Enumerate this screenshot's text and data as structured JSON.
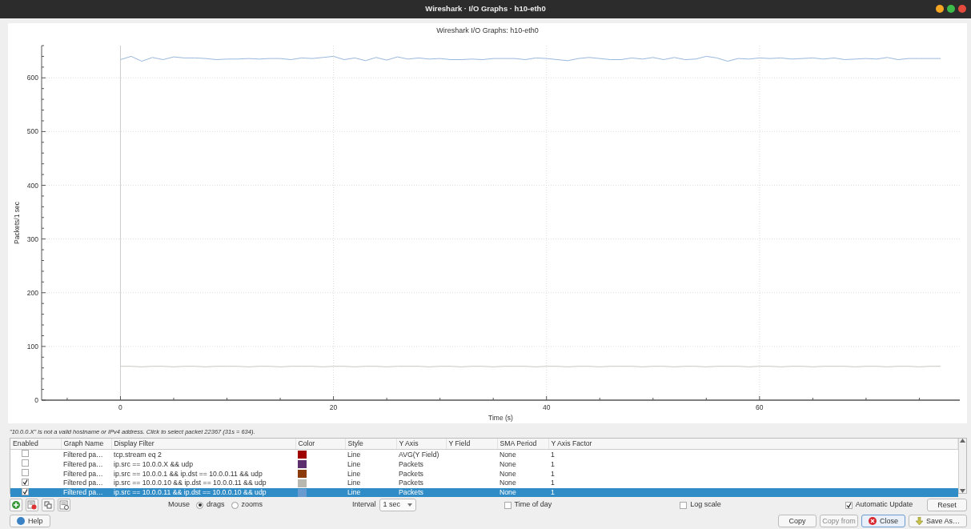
{
  "window": {
    "title": "Wireshark · I/O Graphs · h10-eth0"
  },
  "graph": {
    "chart_data": {
      "type": "line",
      "title": "Wireshark I/O Graphs: h10-eth0",
      "xlabel": "Time (s)",
      "ylabel": "Packets/1 sec",
      "x": [
        0,
        1,
        2,
        3,
        4,
        5,
        6,
        7,
        8,
        9,
        10,
        11,
        12,
        13,
        14,
        15,
        16,
        17,
        18,
        19,
        20,
        21,
        22,
        23,
        24,
        25,
        26,
        27,
        28,
        29,
        30,
        31,
        32,
        33,
        34,
        35,
        36,
        37,
        38,
        39,
        40,
        41,
        42,
        43,
        44,
        45,
        46,
        47,
        48,
        49,
        50,
        51,
        52,
        53,
        54,
        55,
        56,
        57,
        58,
        59,
        60,
        61,
        62,
        63,
        64,
        65,
        66,
        67,
        68,
        69,
        70,
        71,
        72,
        73,
        74,
        75,
        76,
        77
      ],
      "series": [
        {
          "color": "#9ab8dc",
          "values": [
            634,
            640,
            631,
            638,
            634,
            639,
            637,
            637,
            636,
            634,
            635,
            635,
            636,
            635,
            636,
            636,
            634,
            637,
            636,
            638,
            640,
            634,
            637,
            632,
            638,
            633,
            639,
            635,
            637,
            635,
            636,
            634,
            634,
            635,
            634,
            636,
            636,
            636,
            634,
            637,
            636,
            634,
            632,
            636,
            638,
            636,
            634,
            634,
            637,
            635,
            638,
            634,
            638,
            634,
            635,
            640,
            637,
            631,
            636,
            635,
            637,
            636,
            637,
            635,
            636,
            637,
            635,
            637,
            634,
            635,
            636,
            635,
            638,
            634,
            636,
            636,
            636,
            636
          ]
        },
        {
          "color": "#c8c8c2",
          "values": [
            63,
            63,
            62,
            63,
            63,
            62,
            63,
            63,
            62,
            63,
            63,
            63,
            62,
            63,
            63,
            62,
            63,
            63,
            63,
            62,
            63,
            63,
            62,
            63,
            63,
            62,
            63,
            63,
            63,
            62,
            63,
            63,
            62,
            63,
            63,
            62,
            63,
            63,
            63,
            62,
            63,
            63,
            62,
            63,
            63,
            62,
            63,
            63,
            63,
            62,
            63,
            63,
            62,
            63,
            63,
            62,
            63,
            63,
            63,
            62,
            63,
            63,
            62,
            63,
            63,
            62,
            63,
            63,
            63,
            62,
            63,
            63,
            62,
            63,
            63,
            62,
            63,
            63
          ]
        }
      ],
      "xlim": [
        -7.4,
        78.8
      ],
      "ylim": [
        0,
        660
      ],
      "xticks": [
        0,
        20,
        40,
        60
      ],
      "yticks": [
        0,
        100,
        200,
        300,
        400,
        500,
        600
      ],
      "grid": true
    }
  },
  "hint": "\"10.0.0.X\" is not a valid hostname or IPv4 address. Click to select packet 22367 (31s = 634).",
  "table": {
    "columns": [
      "Enabled",
      "Graph Name",
      "Display Filter",
      "Color",
      "Style",
      "Y Axis",
      "Y Field",
      "SMA Period",
      "Y Axis Factor"
    ],
    "rows": [
      {
        "enabled": false,
        "selected": false,
        "graph_name": "Filtered pa…",
        "display_filter": "tcp.stream eq 2",
        "color": "#a00000",
        "style": "Line",
        "y_axis": "AVG(Y Field)",
        "sma_period": "None",
        "y_axis_factor": "1"
      },
      {
        "enabled": false,
        "selected": false,
        "graph_name": "Filtered pa…",
        "display_filter": "ip.src == 10.0.0.X && udp",
        "color": "#5b2f6e",
        "style": "Line",
        "y_axis": "Packets",
        "sma_period": "None",
        "y_axis_factor": "1"
      },
      {
        "enabled": false,
        "selected": false,
        "graph_name": "Filtered pa…",
        "display_filter": "ip.src == 10.0.0.1 && ip.dst == 10.0.0.11 && udp",
        "color": "#8b3a0a",
        "style": "Line",
        "y_axis": "Packets",
        "sma_period": "None",
        "y_axis_factor": "1"
      },
      {
        "enabled": true,
        "selected": false,
        "graph_name": "Filtered pa…",
        "display_filter": "ip.src == 10.0.0.10 && ip.dst == 10.0.0.11 && udp",
        "color": "#b8b8b0",
        "style": "Line",
        "y_axis": "Packets",
        "sma_period": "None",
        "y_axis_factor": "1"
      },
      {
        "enabled": true,
        "selected": true,
        "graph_name": "Filtered pa…",
        "display_filter": "ip.src == 10.0.0.11 && ip.dst == 10.0.0.10 && udp",
        "color": "#6a9bd0",
        "style": "Line",
        "y_axis": "Packets",
        "sma_period": "None",
        "y_axis_factor": "1"
      }
    ]
  },
  "controls": {
    "mouse_label": "Mouse",
    "mouse_modes": [
      {
        "label": "drags",
        "selected": true
      },
      {
        "label": "zooms",
        "selected": false
      }
    ],
    "interval_label": "Interval",
    "interval": "1 sec",
    "options": [
      {
        "label": "Time of day",
        "checked": false
      },
      {
        "label": "Log scale",
        "checked": false
      },
      {
        "label": "Automatic Update",
        "checked": true
      }
    ],
    "reset": "Reset"
  },
  "buttons": [
    {
      "kind": "help",
      "label": "Help",
      "disabled": false,
      "default": false
    },
    {
      "kind": "plain",
      "label": "Copy",
      "disabled": false,
      "default": false
    },
    {
      "kind": "plain",
      "label": "Copy from",
      "disabled": true,
      "default": false
    },
    {
      "kind": "close",
      "label": "Close",
      "disabled": false,
      "default": true
    },
    {
      "kind": "save",
      "label": "Save As…",
      "disabled": false,
      "default": false
    }
  ]
}
